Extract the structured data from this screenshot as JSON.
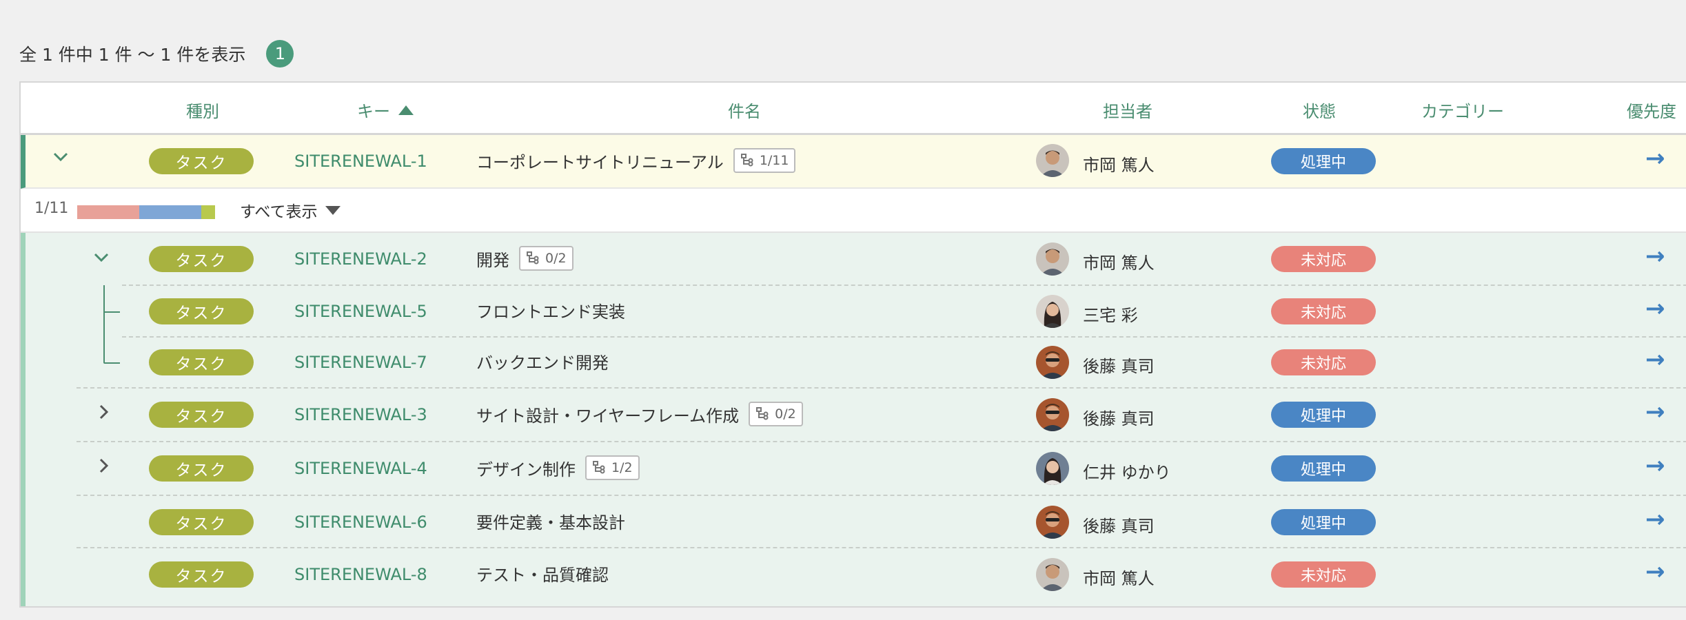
{
  "summary": {
    "text": "全 1 件中 1 件 ～ 1 件を表示",
    "badge": "1"
  },
  "columns": {
    "type": "種別",
    "key": "キー",
    "subject": "件名",
    "assignee": "担当者",
    "status": "状態",
    "category": "カテゴリー",
    "priority": "優先度"
  },
  "parent": {
    "type": "タスク",
    "key": "SITERENEWAL-1",
    "subject": "コーポレートサイトリニューアル",
    "subtasks": "1/11",
    "assignee": "市岡 篤人",
    "status": "処理中"
  },
  "progress": {
    "label": "1/11",
    "show_all": "すべて表示",
    "segments": [
      {
        "color": "#e8a198",
        "fraction": 0.45
      },
      {
        "color": "#7ea6d6",
        "fraction": 0.45
      },
      {
        "color": "#b8c94e",
        "fraction": 0.1
      }
    ]
  },
  "children": [
    {
      "type": "タスク",
      "key": "SITERENEWAL-2",
      "subject": "開発",
      "subtasks": "0/2",
      "assignee": "市岡 篤人",
      "status": "未対応",
      "status_color": "red"
    },
    {
      "type": "タスク",
      "key": "SITERENEWAL-5",
      "subject": "フロントエンド実装",
      "subtasks": "",
      "assignee": "三宅 彩",
      "status": "未対応",
      "status_color": "red"
    },
    {
      "type": "タスク",
      "key": "SITERENEWAL-7",
      "subject": "バックエンド開発",
      "subtasks": "",
      "assignee": "後藤 真司",
      "status": "未対応",
      "status_color": "red"
    },
    {
      "type": "タスク",
      "key": "SITERENEWAL-3",
      "subject": "サイト設計・ワイヤーフレーム作成",
      "subtasks": "0/2",
      "assignee": "後藤 真司",
      "status": "処理中",
      "status_color": "blue"
    },
    {
      "type": "タスク",
      "key": "SITERENEWAL-4",
      "subject": "デザイン制作",
      "subtasks": "1/2",
      "assignee": "仁井 ゆかり",
      "status": "処理中",
      "status_color": "blue"
    },
    {
      "type": "タスク",
      "key": "SITERENEWAL-6",
      "subject": "要件定義・基本設計",
      "subtasks": "",
      "assignee": "後藤 真司",
      "status": "処理中",
      "status_color": "blue"
    },
    {
      "type": "タスク",
      "key": "SITERENEWAL-8",
      "subject": "テスト・品質確認",
      "subtasks": "",
      "assignee": "市岡 篤人",
      "status": "未対応",
      "status_color": "red"
    }
  ],
  "icons": {
    "arrow": "arrow-right-icon",
    "subtask": "subtask-tree-icon",
    "expand": "chevron-down-icon",
    "collapsed": "chevron-right-icon"
  }
}
